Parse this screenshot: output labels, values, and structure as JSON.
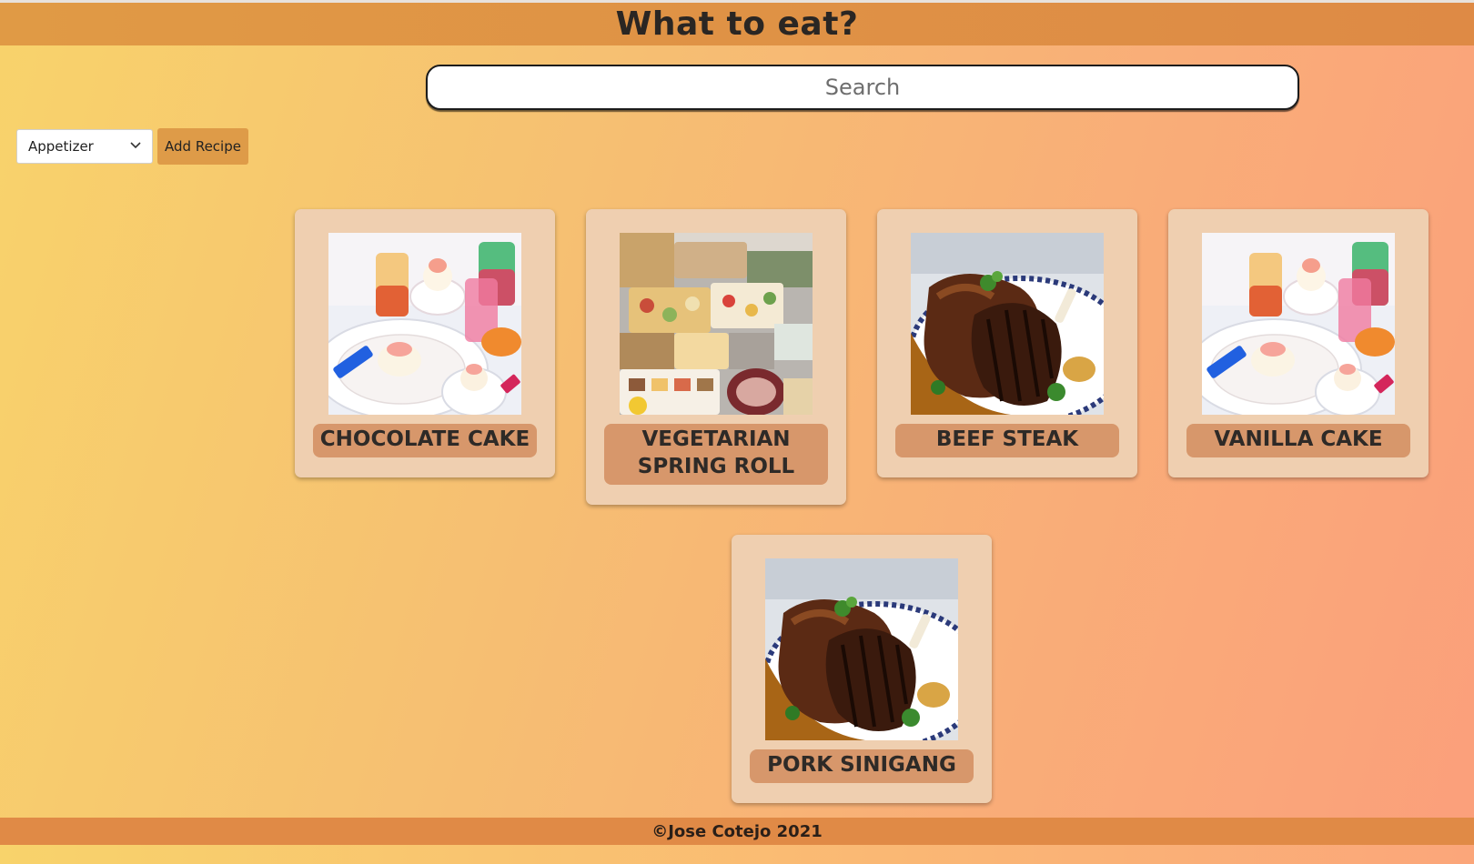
{
  "header": {
    "title": "What to eat?"
  },
  "search": {
    "placeholder": "Search"
  },
  "controls": {
    "category_selected": "Appetizer",
    "add_button": "Add Recipe"
  },
  "recipes": [
    {
      "name": "CHOCOLATE CAKE",
      "image": "dessert-photo"
    },
    {
      "name": "VEGETARIAN SPRING ROLL",
      "image": "buffet-photo"
    },
    {
      "name": "BEEF STEAK",
      "image": "grilled-meat-photo"
    },
    {
      "name": "VANILLA CAKE",
      "image": "dessert-photo"
    },
    {
      "name": "PORK SINIGANG",
      "image": "grilled-meat-photo"
    }
  ],
  "footer": {
    "text": "©Jose Cotejo 2021"
  }
}
